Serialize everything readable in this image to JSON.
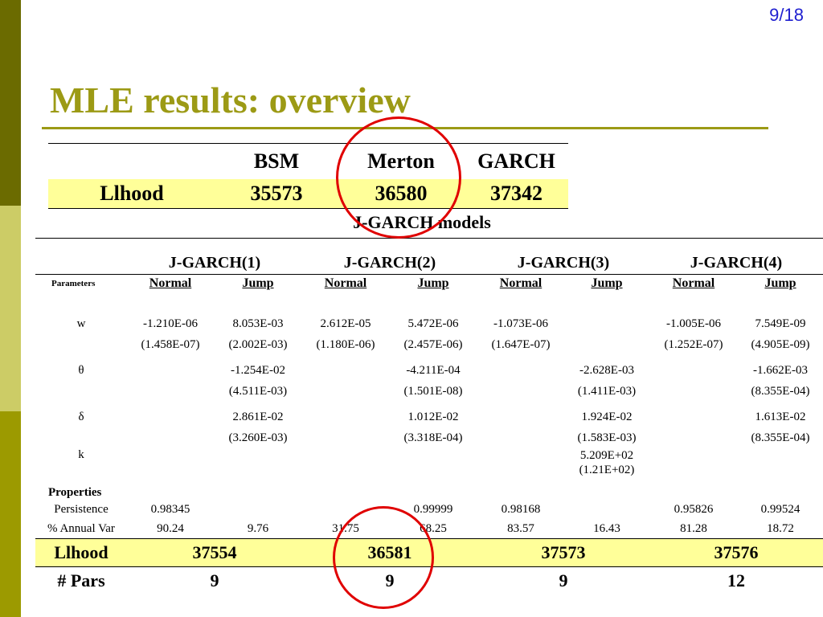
{
  "slide_number": "9/18",
  "title": "MLE results: overview",
  "colors": {
    "title": "#9c9a15",
    "sidebar_dark": "#6b6b00",
    "sidebar_light": "#cccc66",
    "sidebar_mid": "#9c9a00",
    "highlight": "#ffff99",
    "circle": "#e00000"
  },
  "top_table": {
    "headers": [
      "BSM",
      "Merton",
      "GARCH"
    ],
    "row_label": "Llhood",
    "values": [
      "35573",
      "36580",
      "37342"
    ]
  },
  "jgarch_title": "J-GARCH models",
  "models": [
    "J-GARCH(1)",
    "J-GARCH(2)",
    "J-GARCH(3)",
    "J-GARCH(4)"
  ],
  "params_label": "Parameters",
  "subheaders": [
    "Normal",
    "Jump"
  ],
  "rows": {
    "w": {
      "label": "w",
      "values": [
        "-1.210E-06",
        "8.053E-03",
        "2.612E-05",
        "5.472E-06",
        "-1.073E-06",
        "",
        "-1.005E-06",
        "7.549E-09"
      ],
      "se": [
        "(1.458E-07)",
        "(2.002E-03)",
        "(1.180E-06)",
        "(2.457E-06)",
        "(1.647E-07)",
        "",
        "(1.252E-07)",
        "(4.905E-09)"
      ]
    },
    "theta": {
      "label": "θ",
      "values": [
        "",
        "-1.254E-02",
        "",
        "-4.211E-04",
        "",
        "-2.628E-03",
        "",
        "-1.662E-03"
      ],
      "se": [
        "",
        "(4.511E-03)",
        "",
        "(1.501E-08)",
        "",
        "(1.411E-03)",
        "",
        "(8.355E-04)"
      ]
    },
    "delta": {
      "label": "δ",
      "values": [
        "",
        "2.861E-02",
        "",
        "1.012E-02",
        "",
        "1.924E-02",
        "",
        "1.613E-02"
      ],
      "se": [
        "",
        "(3.260E-03)",
        "",
        "(3.318E-04)",
        "",
        "(1.583E-03)",
        "",
        "(8.355E-04)"
      ]
    },
    "k": {
      "label": "k",
      "value": "5.209E+02",
      "se": "(1.21E+02)"
    }
  },
  "properties_label": "Properties",
  "persistence": {
    "label": "Persistence",
    "values": [
      "0.98345",
      "",
      "",
      "0.99999",
      "0.98168",
      "",
      "0.95826",
      "0.99524"
    ]
  },
  "annual_var": {
    "label": "% Annual Var",
    "values": [
      "90.24",
      "9.76",
      "31.75",
      "68.25",
      "83.57",
      "16.43",
      "81.28",
      "18.72"
    ]
  },
  "llhood": {
    "label": "Llhood",
    "values": [
      "37554",
      "36581",
      "37573",
      "37576"
    ]
  },
  "pars": {
    "label": "# Pars",
    "values": [
      "9",
      "9",
      "9",
      "12"
    ]
  }
}
